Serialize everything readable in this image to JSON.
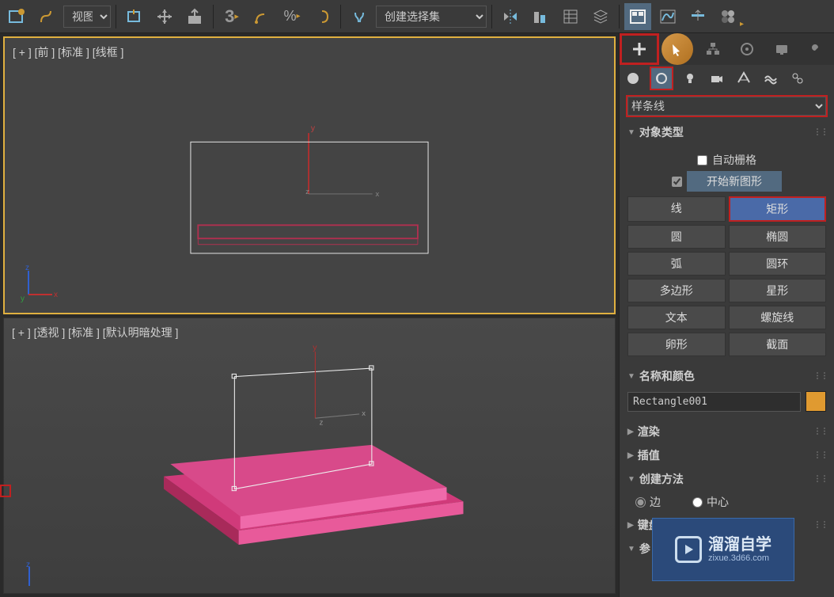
{
  "toolbar": {
    "view_dropdown": "视图",
    "create_sel_dropdown": "创建选择集",
    "three_label": "3"
  },
  "viewports": {
    "front_label": "[ + ] [前 ] [标准 ] [线框 ]",
    "persp_label": "[ + ] [透视 ] [标准 ] [默认明暗处理 ]"
  },
  "panel": {
    "spline_dropdown": "样条线",
    "obj_type_header": "对象类型",
    "auto_grid_label": "自动栅格",
    "start_new_shape": "开始新图形",
    "shapes": {
      "line": "线",
      "rectangle": "矩形",
      "circle": "圆",
      "ellipse": "椭圆",
      "arc": "弧",
      "donut": "圆环",
      "polygon": "多边形",
      "star": "星形",
      "text": "文本",
      "helix": "螺旋线",
      "egg": "卵形",
      "section": "截面"
    },
    "name_color_header": "名称和颜色",
    "object_name": "Rectangle001",
    "object_color": "#e09a30",
    "render_header": "渲染",
    "interp_header": "插值",
    "creation_header": "创建方法",
    "edge_label": "边",
    "center_label": "中心",
    "keyboard_header": "键盘输入",
    "params_header": "参"
  },
  "watermark": {
    "title": "溜溜自学",
    "sub": "zixue.3d66.com"
  }
}
